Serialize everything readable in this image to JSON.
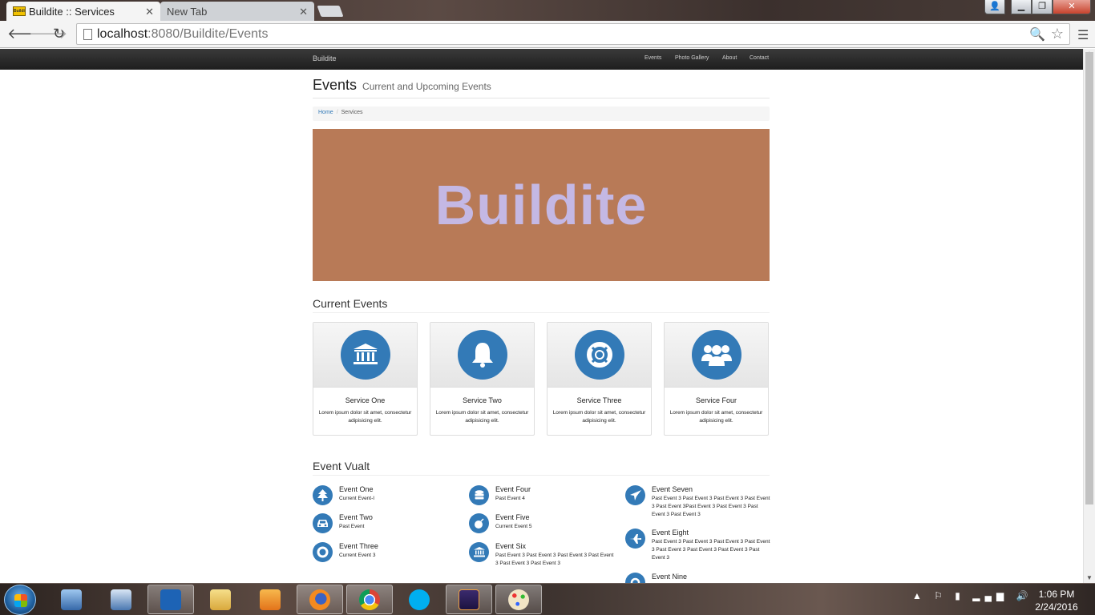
{
  "browser": {
    "tabs": [
      {
        "title": "Buildite :: Services",
        "favicon_text": "Buildite"
      },
      {
        "title": "New Tab"
      }
    ],
    "url_host": "localhost",
    "url_rest": ":8080/Buildite/Events"
  },
  "site": {
    "brand": "Buildite",
    "nav": [
      "Events",
      "Photo Gallery",
      "About",
      "Contact"
    ],
    "title": "Events",
    "subtitle": "Current and Upcoming Events",
    "breadcrumb": {
      "home": "Home",
      "current": "Services"
    },
    "banner_text": "Buildite",
    "banner_color": "#b87a57",
    "accent": "#337ab7",
    "current_events_title": "Current Events",
    "services": [
      {
        "name": "Service One",
        "icon": "bank-icon",
        "desc": "Lorem ipsum dolor sit amet, consectetur adipisicing elit."
      },
      {
        "name": "Service Two",
        "icon": "bell-icon",
        "desc": "Lorem ipsum dolor sit amet, consectetur adipisicing elit."
      },
      {
        "name": "Service Three",
        "icon": "life-ring-icon",
        "desc": "Lorem ipsum dolor sit amet, consectetur adipisicing elit."
      },
      {
        "name": "Service Four",
        "icon": "users-icon",
        "desc": "Lorem ipsum dolor sit amet, consectetur adipisicing elit."
      }
    ],
    "vault_title": "Event Vualt",
    "vault": [
      {
        "name": "Event One",
        "desc": "Current Event-I",
        "icon": "tree-icon"
      },
      {
        "name": "Event Two",
        "desc": "Past Event",
        "icon": "car-icon"
      },
      {
        "name": "Event Three",
        "desc": "Current Event 3",
        "icon": "life-ring-icon"
      },
      {
        "name": "Event Four",
        "desc": "Past Event 4",
        "icon": "database-icon"
      },
      {
        "name": "Event Five",
        "desc": "Current Event 5",
        "icon": "bomb-icon"
      },
      {
        "name": "Event Six",
        "desc": "Past Event 3 Past Event 3 Past Event 3 Past Event 3 Past Event 3 Past Event 3",
        "icon": "bank-icon"
      },
      {
        "name": "Event Seven",
        "desc": "Past Event 3 Past Event 3 Past Event 3 Past Event 3 Past Event 3Past Event 3 Past Event 3 Past Event 3 Past Event 3",
        "icon": "paper-plane-icon"
      },
      {
        "name": "Event Eight",
        "desc": "Past Event 3 Past Event 3 Past Event 3 Past Event 3 Past Event 3 Past Event 3 Past Event 3 Past Event 3",
        "icon": "plane-icon"
      },
      {
        "name": "Event Nine",
        "desc": "",
        "icon": "recycle-icon"
      }
    ]
  },
  "taskbar": {
    "time": "1:06 PM",
    "date": "2/24/2016"
  }
}
